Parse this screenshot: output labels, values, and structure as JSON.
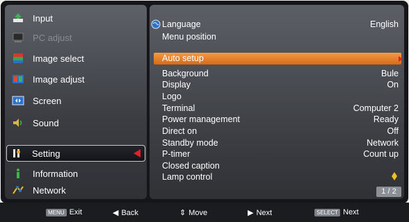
{
  "sidebar": {
    "items": [
      {
        "label": "Input",
        "state": "normal",
        "icon": "input-icon"
      },
      {
        "label": "PC adjust",
        "state": "disabled",
        "icon": "pc-adjust-icon"
      },
      {
        "label": "Image select",
        "state": "normal",
        "icon": "image-select-icon"
      },
      {
        "label": "Image adjust",
        "state": "normal",
        "icon": "image-adjust-icon"
      },
      {
        "label": "Screen",
        "state": "normal",
        "icon": "screen-icon"
      },
      {
        "label": "Sound",
        "state": "normal",
        "icon": "sound-icon"
      },
      {
        "label": "Setting",
        "state": "selected",
        "icon": "setting-icon"
      },
      {
        "label": "Information",
        "state": "normal",
        "icon": "information-icon"
      },
      {
        "label": "Network",
        "state": "normal",
        "icon": "network-icon"
      }
    ]
  },
  "menu": {
    "rows": [
      {
        "label": "Language",
        "value": "English",
        "icon": "globe-icon"
      },
      {
        "label": "Menu position",
        "value": ""
      },
      {
        "label": "Auto setup",
        "value": "",
        "highlight": true
      },
      {
        "label": "Background",
        "value": "Bule"
      },
      {
        "label": "Display",
        "value": "On"
      },
      {
        "label": "Logo",
        "value": ""
      },
      {
        "label": "Terminal",
        "value": "Computer 2"
      },
      {
        "label": "Power management",
        "value": "Ready"
      },
      {
        "label": "Direct on",
        "value": "Off"
      },
      {
        "label": "Standby mode",
        "value": "Network"
      },
      {
        "label": "P-timer",
        "value": "Count up"
      },
      {
        "label": "Closed caption",
        "value": ""
      },
      {
        "label": "Lamp control",
        "value": "",
        "value_icon": "lamp-icon"
      }
    ],
    "page_indicator": "1 / 2"
  },
  "bottom_bar": {
    "exit": {
      "key": "MENU",
      "label": "Exit"
    },
    "back": {
      "label": "Back"
    },
    "move": {
      "label": "Move"
    },
    "next_arrow": {
      "label": "Next"
    },
    "select_next": {
      "key": "SELECT",
      "label": "Next"
    }
  },
  "colors": {
    "highlight": "#e67e22",
    "selected_marker": "#e0202a",
    "panel": "#3b3d42"
  }
}
